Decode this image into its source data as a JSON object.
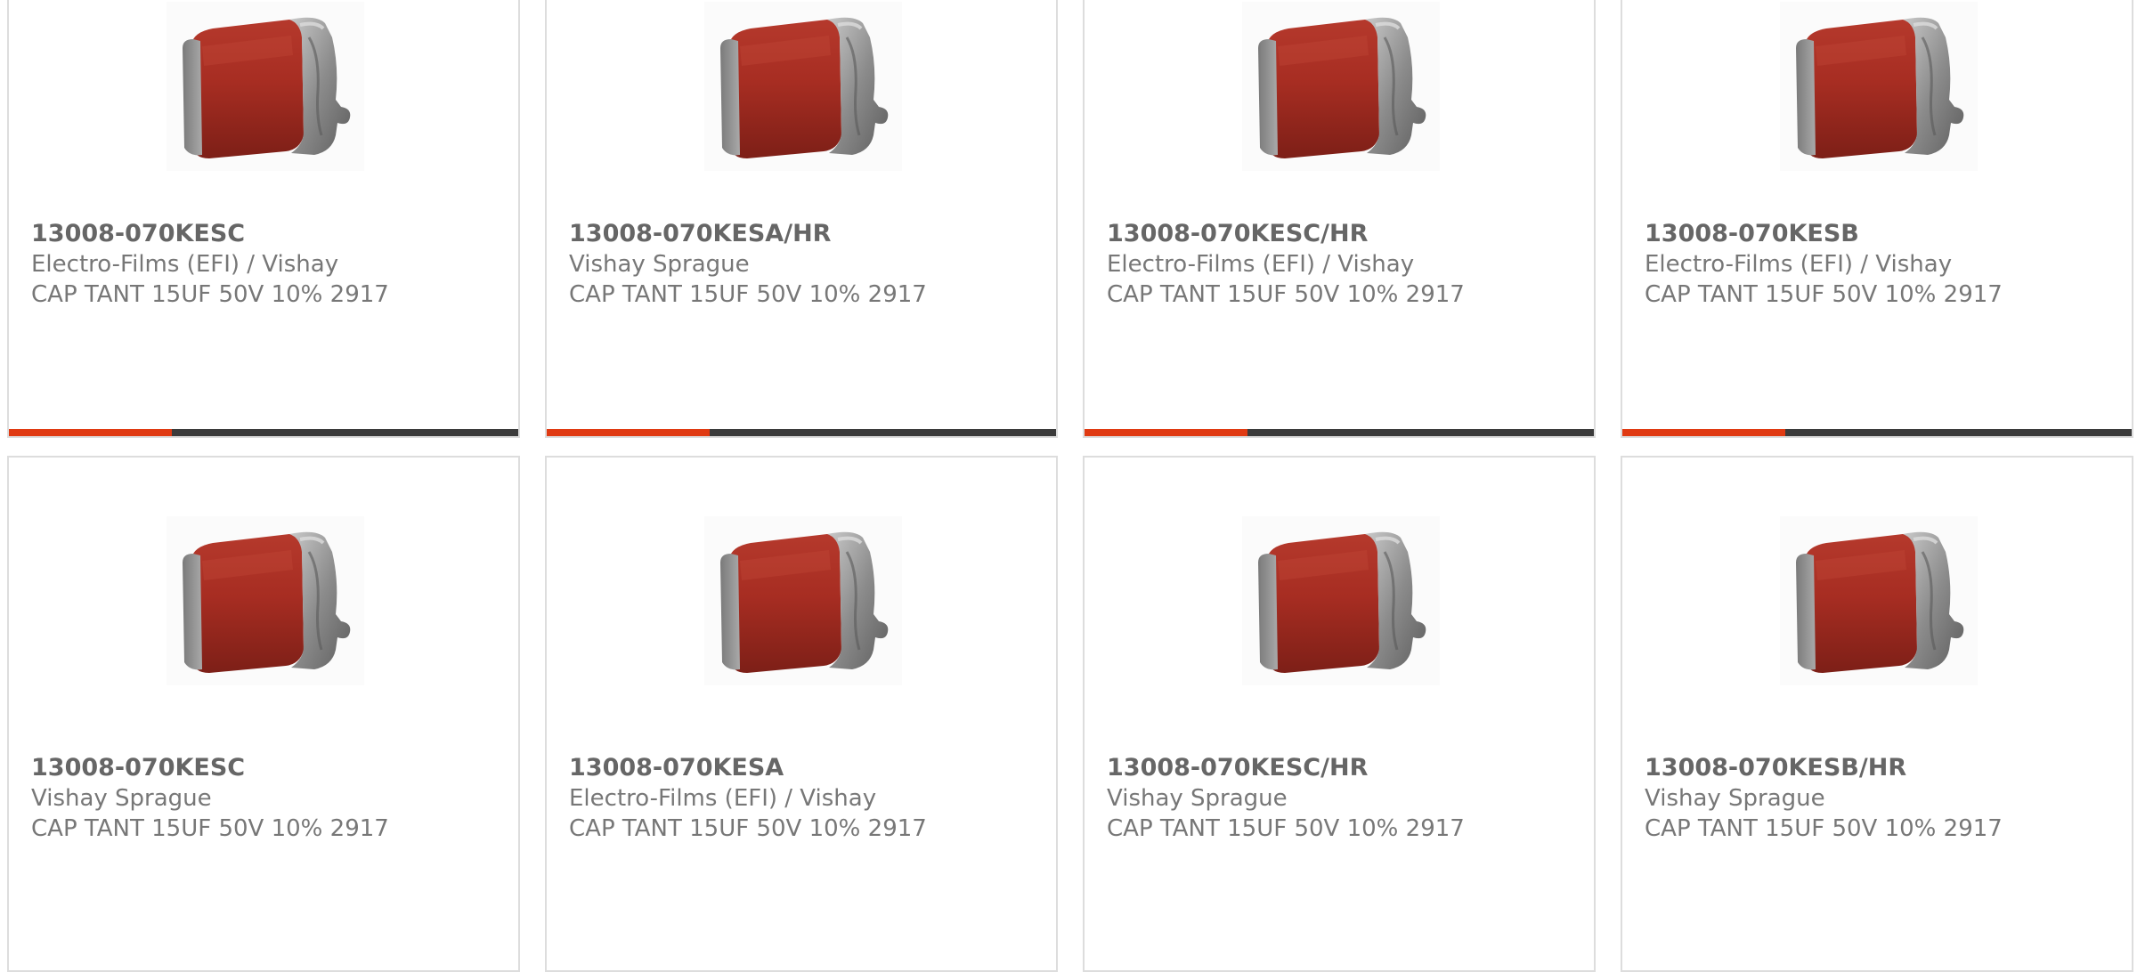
{
  "products": [
    {
      "part_number": "13008-070KESC",
      "manufacturer": "Electro-Films (EFI) / Vishay",
      "description": "CAP TANT 15UF 50V 10% 2917",
      "image_icon": "tantalum-capacitor-icon",
      "progress": 0.32
    },
    {
      "part_number": "13008-070KESA/HR",
      "manufacturer": "Vishay Sprague",
      "description": "CAP TANT 15UF 50V 10% 2917",
      "image_icon": "tantalum-capacitor-icon",
      "progress": 0.32
    },
    {
      "part_number": "13008-070KESC/HR",
      "manufacturer": "Electro-Films (EFI) / Vishay",
      "description": "CAP TANT 15UF 50V 10% 2917",
      "image_icon": "tantalum-capacitor-icon",
      "progress": 0.32
    },
    {
      "part_number": "13008-070KESB",
      "manufacturer": "Electro-Films (EFI) / Vishay",
      "description": "CAP TANT 15UF 50V 10% 2917",
      "image_icon": "tantalum-capacitor-icon",
      "progress": 0.32
    },
    {
      "part_number": "13008-070KESC",
      "manufacturer": "Vishay Sprague",
      "description": "CAP TANT 15UF 50V 10% 2917",
      "image_icon": "tantalum-capacitor-icon"
    },
    {
      "part_number": "13008-070KESA",
      "manufacturer": "Electro-Films (EFI) / Vishay",
      "description": "CAP TANT 15UF 50V 10% 2917",
      "image_icon": "tantalum-capacitor-icon"
    },
    {
      "part_number": "13008-070KESC/HR",
      "manufacturer": "Vishay Sprague",
      "description": "CAP TANT 15UF 50V 10% 2917",
      "image_icon": "tantalum-capacitor-icon"
    },
    {
      "part_number": "13008-070KESB/HR",
      "manufacturer": "Vishay Sprague",
      "description": "CAP TANT 15UF 50V 10% 2917",
      "image_icon": "tantalum-capacitor-icon"
    }
  ],
  "colors": {
    "accent": "#e03a12",
    "bar_track": "#3b3b3b",
    "card_border": "#dddddd",
    "text": "#666666"
  }
}
